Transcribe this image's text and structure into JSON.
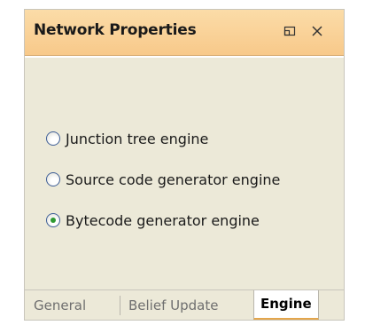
{
  "window": {
    "title": "Network Properties",
    "buttons": {
      "maximize_icon": "maximize-icon",
      "close_icon": "close-icon"
    }
  },
  "engine_options": [
    {
      "label": "Junction tree engine",
      "selected": false
    },
    {
      "label": "Source code generator engine",
      "selected": false
    },
    {
      "label": "Bytecode generator engine",
      "selected": true
    }
  ],
  "tabs": [
    {
      "label": "General",
      "active": false
    },
    {
      "label": "Belief Update",
      "active": false
    },
    {
      "label": "Engine",
      "active": true
    }
  ],
  "colors": {
    "title_bar": "#f8c98a",
    "panel_bg": "#ece9d8",
    "radio_check": "#2f9a31",
    "active_tab_accent": "#e4a64b"
  }
}
